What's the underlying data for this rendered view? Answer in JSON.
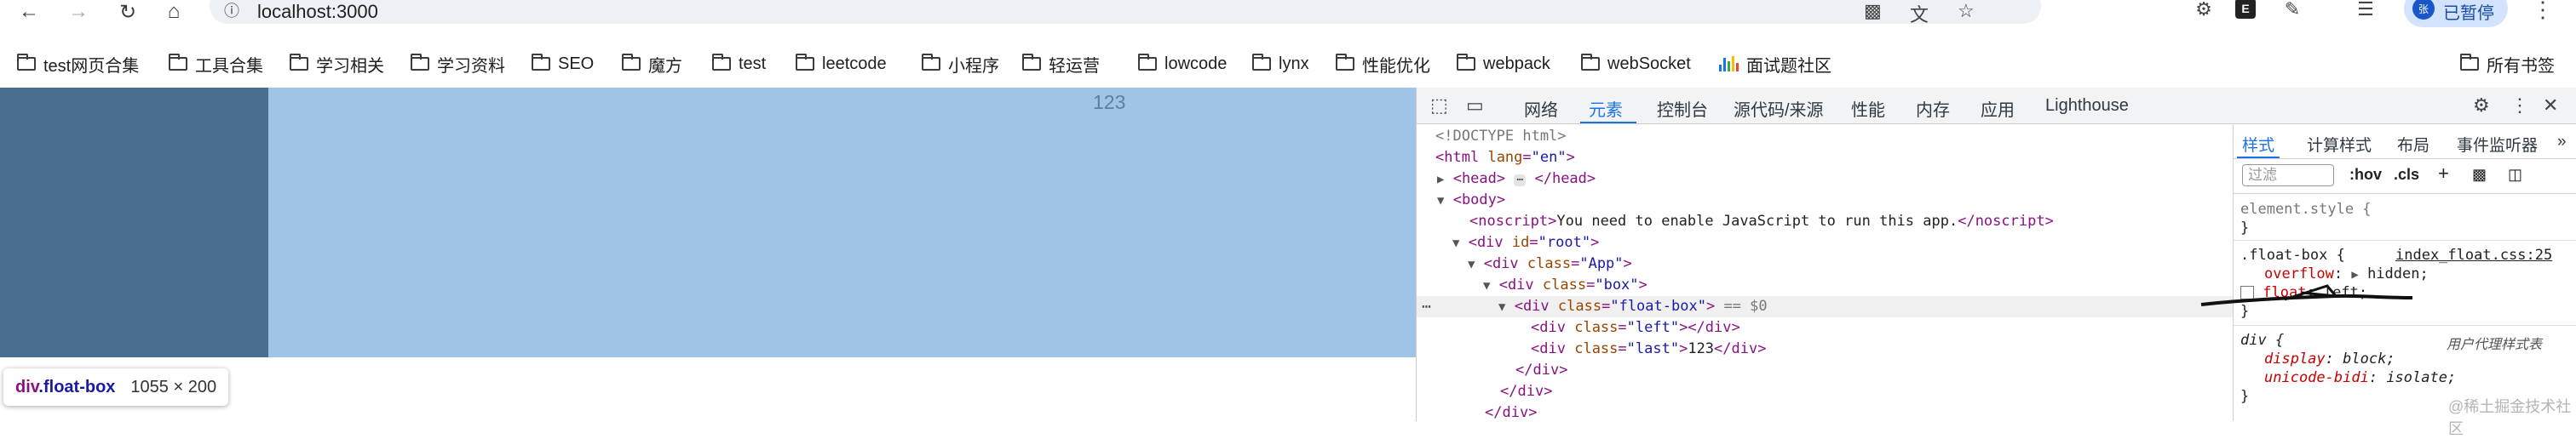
{
  "browser": {
    "url": "localhost:3000",
    "profile_button": "已暂停",
    "profile_avatar": "张"
  },
  "bookmarks": [
    {
      "label": "test网页合集"
    },
    {
      "label": "工具合集"
    },
    {
      "label": "学习相关"
    },
    {
      "label": "学习资料"
    },
    {
      "label": "SEO"
    },
    {
      "label": "魔方"
    },
    {
      "label": "test"
    },
    {
      "label": "leetcode"
    },
    {
      "label": "小程序"
    },
    {
      "label": "轻运营"
    },
    {
      "label": "lowcode"
    },
    {
      "label": "lynx"
    },
    {
      "label": "性能优化"
    },
    {
      "label": "webpack"
    },
    {
      "label": "webSocket"
    },
    {
      "label": "面试题社区"
    }
  ],
  "all_bookmarks": "所有书签",
  "page": {
    "last_text": "123",
    "tooltip": {
      "tag": "div",
      "cls": ".float-box",
      "size": "1055 × 200"
    }
  },
  "devtools": {
    "tabs": [
      "网络",
      "元素",
      "控制台",
      "源代码/来源",
      "性能",
      "内存",
      "应用",
      "Lighthouse"
    ],
    "active_tab": "元素",
    "styles_tabs": [
      "样式",
      "计算样式",
      "布局",
      "事件监听器"
    ],
    "filter_placeholder": "过滤",
    "hov": ":hov",
    "cls": ".cls",
    "dom": {
      "doctype": "<!DOCTYPE html>",
      "html_open": "html",
      "html_attr": "lang",
      "html_val": "\"en\"",
      "head": "head",
      "body": "body",
      "noscript": "noscript",
      "noscript_text": "You need to enable JavaScript to run this app.",
      "div": "div",
      "id_attr": "id",
      "id_val": "\"root\"",
      "class_attr": "class",
      "app_val": "\"App\"",
      "box_val": "\"box\"",
      "float_val": "\"float-box\"",
      "left_val": "\"left\"",
      "last_val": "\"last\"",
      "last_text": "123",
      "selected_marker": "== $0"
    },
    "styles": {
      "element_style": "element.style {",
      "close": "}",
      "float_selector": ".float-box {",
      "float_source": "index_float.css:25",
      "overflow_prop": "overflow",
      "overflow_val": "hidden;",
      "float_prop": "float",
      "float_val": "left;",
      "div_selector": "div {",
      "ua_label": "用户代理样式表",
      "display_prop": "display",
      "display_val": "block;",
      "bidi_prop": "unicode-bidi",
      "bidi_val": "isolate;"
    }
  },
  "watermark": "@稀土掘金技术社区"
}
